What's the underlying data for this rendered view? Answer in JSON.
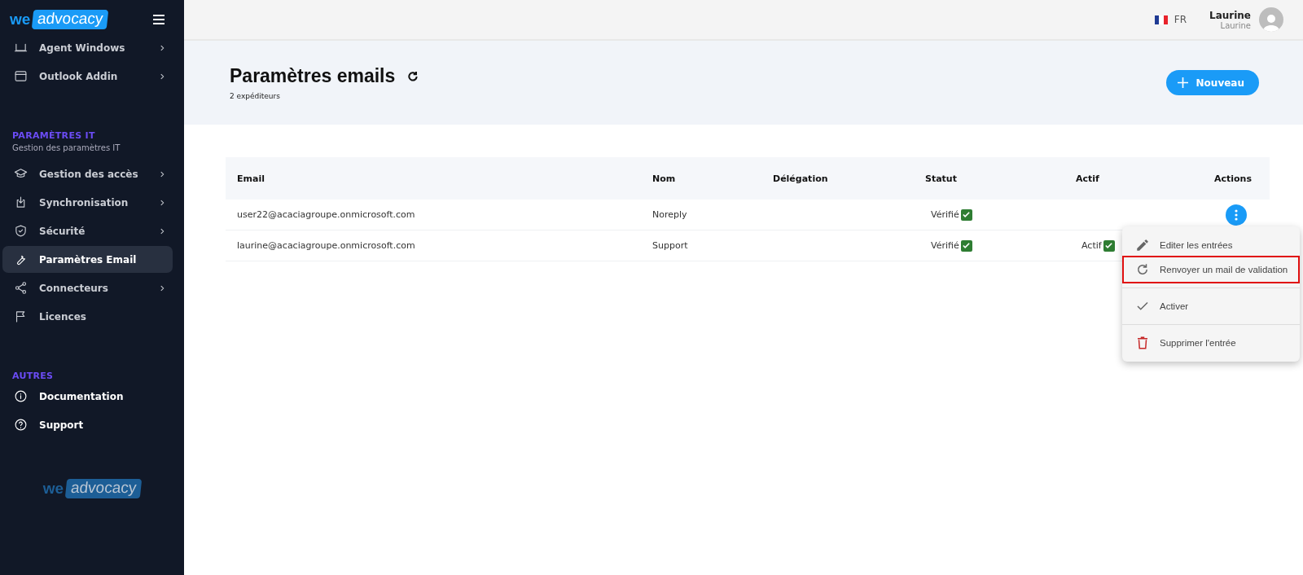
{
  "sidebar": {
    "logo": {
      "prefix": "we",
      "name": "advocacy"
    },
    "sections": [
      {
        "items": [
          {
            "label": "Agent Windows",
            "submenu": true,
            "selected": false
          },
          {
            "label": "Outlook Addin",
            "submenu": true,
            "selected": false
          }
        ]
      },
      {
        "title": "PARAMÈTRES IT",
        "subtitle": "Gestion des paramètres IT",
        "items": [
          {
            "label": "Gestion des accès",
            "submenu": true,
            "selected": false
          },
          {
            "label": "Synchronisation",
            "submenu": true,
            "selected": false
          },
          {
            "label": "Sécurité",
            "submenu": true,
            "selected": false
          },
          {
            "label": "Paramètres Email",
            "submenu": false,
            "selected": true
          },
          {
            "label": "Connecteurs",
            "submenu": true,
            "selected": false
          },
          {
            "label": "Licences",
            "submenu": false,
            "selected": false
          }
        ]
      },
      {
        "title": "AUTRES",
        "items": [
          {
            "label": "Documentation",
            "submenu": false,
            "selected": false
          },
          {
            "label": "Support",
            "submenu": false,
            "selected": false
          }
        ]
      }
    ],
    "footer_logo": {
      "prefix": "we",
      "name": "advocacy"
    }
  },
  "topbar": {
    "language": "FR",
    "user": {
      "name": "Laurine",
      "subtitle": "Laurine"
    }
  },
  "header": {
    "title": "Paramètres emails",
    "subtitle": "2 expéditeurs",
    "new_button": "Nouveau"
  },
  "table": {
    "columns": [
      "Email",
      "Nom",
      "Délégation",
      "Statut",
      "Actif",
      "Actions"
    ],
    "rows": [
      {
        "email": "user22@acaciagroupe.onmicrosoft.com",
        "name": "Noreply",
        "status": {
          "text": "Vérifié",
          "checked": true
        },
        "actions_button": true
      },
      {
        "email": "laurine@acaciagroupe.onmicrosoft.com",
        "name": "Support",
        "status": {
          "text": "Vérifié",
          "checked": true
        },
        "active": {
          "text": "Actif",
          "checked": true
        },
        "actions_button": false
      }
    ]
  },
  "context_menu": {
    "items": [
      {
        "kind": "edit",
        "label": "Editer les entrées",
        "highlighted": false,
        "divider_after": false
      },
      {
        "kind": "resend",
        "label": "Renvoyer un mail de validation",
        "highlighted": true,
        "divider_after": true
      },
      {
        "kind": "activate",
        "label": "Activer",
        "highlighted": false,
        "divider_after": true
      },
      {
        "kind": "delete",
        "label": "Supprimer l'entrée",
        "highlighted": false,
        "divider_after": false
      }
    ]
  }
}
